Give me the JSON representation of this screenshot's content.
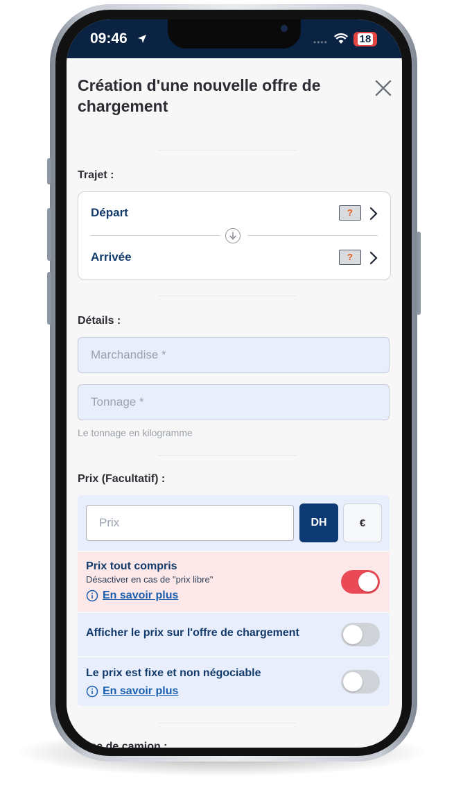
{
  "status_bar": {
    "time": "09:46",
    "battery": "18"
  },
  "header": {
    "title": "Création d'une nouvelle offre de chargement"
  },
  "trajet": {
    "label": "Trajet :",
    "depart": {
      "label": "Départ",
      "badge": "?"
    },
    "arrivee": {
      "label": "Arrivée",
      "badge": "?"
    }
  },
  "details": {
    "label": "Détails :",
    "marchandise_placeholder": "Marchandise *",
    "tonnage_placeholder": "Tonnage *",
    "tonnage_hint": "Le tonnage en kilogramme"
  },
  "prix": {
    "label": "Prix (Facultatif) :",
    "placeholder": "Prix",
    "currency_dh": "DH",
    "currency_eur": "€",
    "selected_currency": "DH"
  },
  "options": {
    "tout_compris": {
      "title": "Prix tout compris",
      "subtitle": "Désactiver en cas de \"prix libre\"",
      "link": "En savoir plus",
      "enabled": true
    },
    "afficher_prix": {
      "title": "Afficher le prix sur l'offre de chargement",
      "enabled": false
    },
    "prix_fixe": {
      "title": "Le prix est fixe et non négociable",
      "link": "En savoir plus",
      "enabled": false
    }
  },
  "next_section": {
    "label": "Type de camion :"
  },
  "colors": {
    "navy": "#0e3a73",
    "toggle_on": "#e94a55",
    "accent_orange": "#e65a1c"
  }
}
